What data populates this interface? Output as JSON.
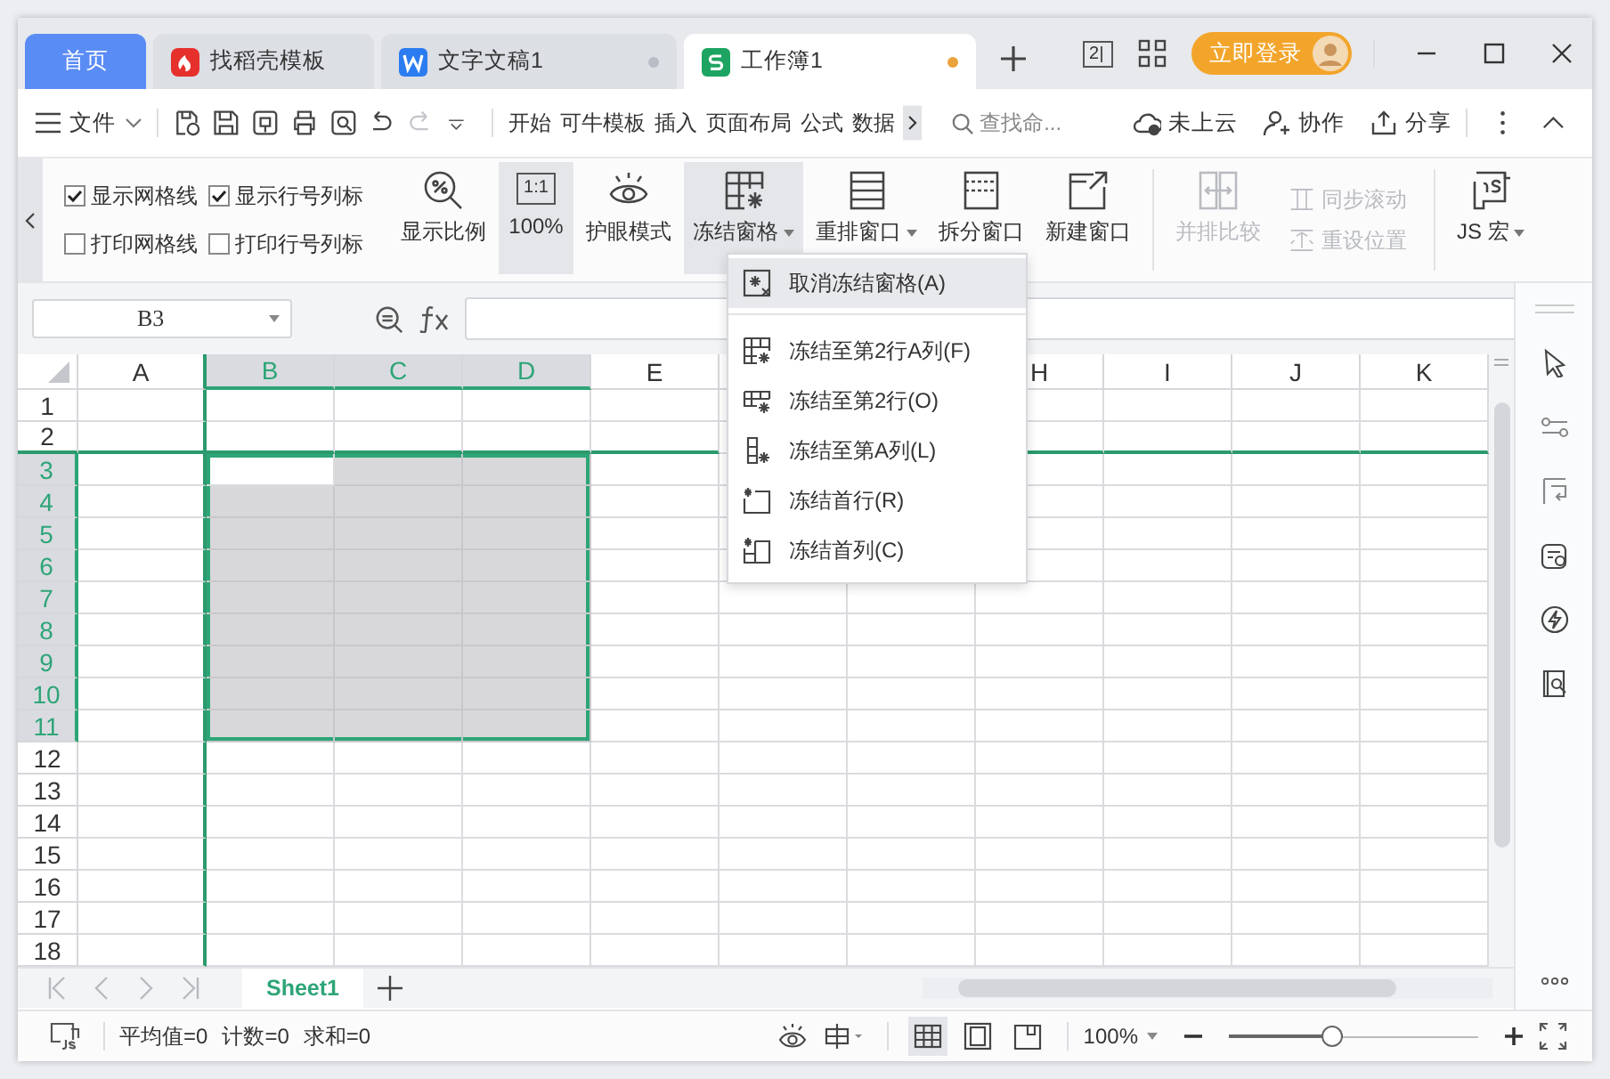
{
  "title_bar": {
    "tabs": [
      {
        "label": "首页",
        "kind": "home",
        "selected": false,
        "unsaved": false
      },
      {
        "label": "找稻壳模板",
        "kind": "docer",
        "selected": false,
        "unsaved": false
      },
      {
        "label": "文字文稿1",
        "kind": "writer",
        "selected": false,
        "unsaved": true
      },
      {
        "label": "工作簿1",
        "kind": "sheet",
        "selected": true,
        "unsaved": true
      }
    ],
    "workspace_badge": "2",
    "login_button": "立即登录"
  },
  "toolbar": {
    "file_menu": "文件",
    "quick_tools": [
      {
        "kind": "save-cloud",
        "disabled": false
      },
      {
        "kind": "save",
        "disabled": false
      },
      {
        "kind": "export",
        "disabled": false
      },
      {
        "kind": "print",
        "disabled": false
      },
      {
        "kind": "preview",
        "disabled": false
      },
      {
        "kind": "undo",
        "disabled": false
      },
      {
        "kind": "redo",
        "disabled": true
      }
    ],
    "menus": [
      "开始",
      "可牛模板",
      "插入",
      "页面布局",
      "公式",
      "数据"
    ],
    "search": {
      "placeholder": "查找命..."
    },
    "actions": [
      {
        "label": "未上云",
        "kind": "cloud"
      },
      {
        "label": "协作",
        "kind": "collab"
      },
      {
        "label": "分享",
        "kind": "share"
      }
    ]
  },
  "ribbon": {
    "checkboxes": [
      {
        "label": "显示网格线",
        "checked": true
      },
      {
        "label": "显示行号列标",
        "checked": true
      },
      {
        "label": "打印网格线",
        "checked": false
      },
      {
        "label": "打印行号列标",
        "checked": false
      }
    ],
    "buttons": [
      {
        "label": "显示比例",
        "kind": "zoom",
        "selected": false,
        "dropdown": false,
        "disabled": false
      },
      {
        "label": "100%",
        "kind": "actual-size",
        "icon_text": "1:1",
        "selected": true,
        "dropdown": false,
        "disabled": false
      },
      {
        "label": "护眼模式",
        "kind": "eye",
        "selected": false,
        "dropdown": false,
        "disabled": false
      },
      {
        "label": "冻结窗格",
        "kind": "freeze",
        "selected": true,
        "dropdown": true,
        "disabled": false
      },
      {
        "label": "重排窗口",
        "kind": "arrange",
        "selected": false,
        "dropdown": true,
        "disabled": false
      },
      {
        "label": "拆分窗口",
        "kind": "split",
        "selected": false,
        "dropdown": false,
        "disabled": false
      },
      {
        "label": "新建窗口",
        "kind": "new-window",
        "selected": false,
        "dropdown": false,
        "disabled": false
      },
      {
        "label": "并排比较",
        "kind": "compare",
        "selected": false,
        "dropdown": false,
        "disabled": true
      },
      {
        "label": "同步滚动",
        "kind": "sync-scroll",
        "selected": false,
        "dropdown": false,
        "disabled": true
      },
      {
        "label": "重设位置",
        "kind": "reset-position",
        "selected": false,
        "dropdown": false,
        "disabled": true
      },
      {
        "label": "JS 宏",
        "kind": "macro",
        "selected": false,
        "dropdown": true,
        "disabled": false
      }
    ]
  },
  "formula_bar": {
    "name_box": "B3"
  },
  "grid": {
    "columns": [
      {
        "label": "A",
        "selected": false,
        "freeze_line": true
      },
      {
        "label": "B",
        "selected": true,
        "freeze_line": false
      },
      {
        "label": "C",
        "selected": true,
        "freeze_line": false
      },
      {
        "label": "D",
        "selected": true,
        "freeze_line": false
      },
      {
        "label": "E",
        "selected": false,
        "freeze_line": false
      },
      {
        "freeze_line": false
      },
      {
        "freeze_line": false
      },
      {
        "label": "H",
        "selected": false,
        "freeze_line": false
      },
      {
        "label": "I",
        "selected": false,
        "freeze_line": false
      },
      {
        "label": "J",
        "selected": false,
        "freeze_line": false
      },
      {
        "label": "K",
        "selected": false,
        "freeze_line": false
      }
    ],
    "rows": [
      {
        "label": "1",
        "selected": false,
        "freeze_line": false
      },
      {
        "label": "2",
        "selected": false,
        "freeze_line": true
      },
      {
        "label": "3",
        "selected": true,
        "freeze_line": false
      },
      {
        "label": "4",
        "selected": true,
        "freeze_line": false
      },
      {
        "label": "5",
        "selected": true,
        "freeze_line": false
      },
      {
        "label": "6",
        "selected": true,
        "freeze_line": false
      },
      {
        "label": "7",
        "selected": true,
        "freeze_line": false
      },
      {
        "label": "8",
        "selected": true,
        "freeze_line": false
      },
      {
        "label": "9",
        "selected": true,
        "freeze_line": false
      },
      {
        "label": "10",
        "selected": true,
        "freeze_line": false
      },
      {
        "label": "11",
        "selected": true,
        "freeze_line": false
      },
      {
        "label": "12",
        "selected": false,
        "freeze_line": false
      },
      {
        "label": "13",
        "selected": false,
        "freeze_line": false
      },
      {
        "label": "14",
        "selected": false,
        "freeze_line": false
      },
      {
        "label": "15",
        "selected": false,
        "freeze_line": false
      },
      {
        "label": "16",
        "selected": false,
        "freeze_line": false
      },
      {
        "label": "17",
        "selected": false,
        "freeze_line": false
      },
      {
        "label": "18",
        "selected": false,
        "freeze_line": false
      }
    ]
  },
  "freeze_menu": {
    "items": [
      {
        "label": "取消冻结窗格(A)",
        "kind": "unfreeze",
        "selected": true
      },
      {
        "label": "冻结至第2行A列(F)",
        "kind": "freeze-cell",
        "selected": false
      },
      {
        "label": "冻结至第2行(O)",
        "kind": "freeze-rows",
        "selected": false
      },
      {
        "label": "冻结至第A列(L)",
        "kind": "freeze-cols",
        "selected": false
      },
      {
        "label": "冻结首行(R)",
        "kind": "freeze-first-row",
        "selected": false
      },
      {
        "label": "冻结首列(C)",
        "kind": "freeze-first-col",
        "selected": false
      }
    ]
  },
  "sheet_tabs": [
    {
      "label": "Sheet1",
      "selected": true
    }
  ],
  "status_bar": {
    "stats": [
      "平均值=0",
      "计数=0",
      "求和=0"
    ],
    "view_modes": [
      {
        "kind": "normal",
        "selected": true
      },
      {
        "kind": "page-break",
        "selected": false
      },
      {
        "kind": "page-layout",
        "selected": false
      }
    ],
    "zoom": "100%",
    "zoom_slider": {
      "level": 0.46
    }
  }
}
